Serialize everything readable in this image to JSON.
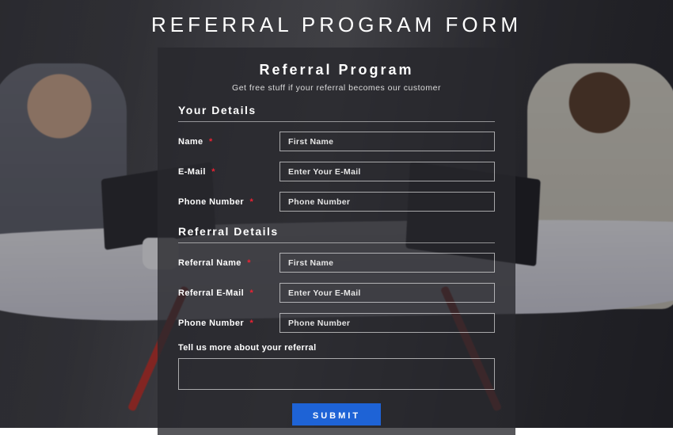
{
  "page_title": "REFERRAL PROGRAM FORM",
  "card": {
    "title": "Referral Program",
    "subtitle": "Get free stuff if your referral becomes our customer"
  },
  "sections": {
    "your_details": {
      "title": "Your Details",
      "fields": {
        "name": {
          "label": "Name",
          "placeholder": "First Name",
          "required": true
        },
        "email": {
          "label": "E-Mail",
          "placeholder": "Enter Your E-Mail",
          "required": true
        },
        "phone": {
          "label": "Phone Number",
          "placeholder": "Phone Number",
          "required": true
        }
      }
    },
    "referral_details": {
      "title": "Referral Details",
      "fields": {
        "name": {
          "label": "Referral Name",
          "placeholder": "First Name",
          "required": true
        },
        "email": {
          "label": "Referral E-Mail",
          "placeholder": "Enter Your E-Mail",
          "required": true
        },
        "phone": {
          "label": "Phone Number",
          "placeholder": "Phone Number",
          "required": true
        }
      },
      "textarea_label": "Tell us more about your referral"
    }
  },
  "submit_label": "SUBMIT",
  "required_marker": "*",
  "colors": {
    "accent": "#1e63d6",
    "required": "#e23"
  }
}
